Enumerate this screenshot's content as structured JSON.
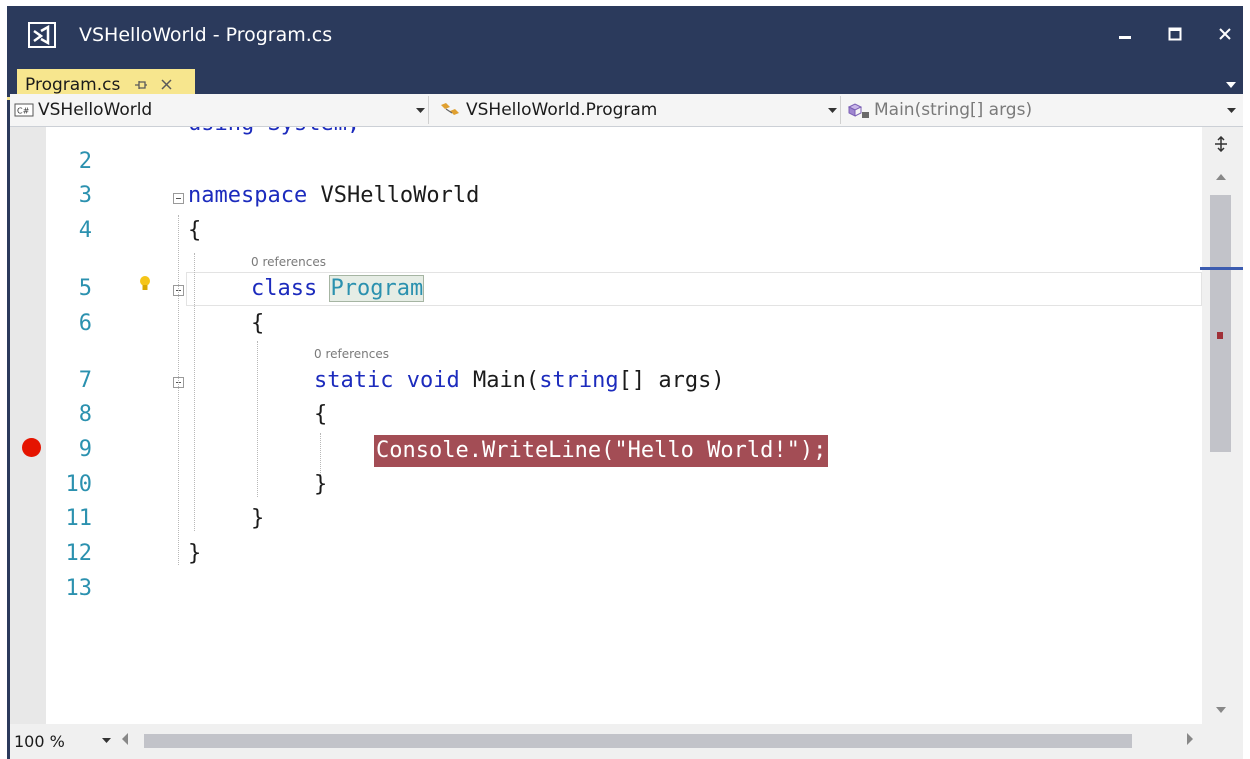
{
  "window": {
    "title": "VSHelloWorld - Program.cs"
  },
  "tab": {
    "label": "Program.cs"
  },
  "nav": {
    "project": "VSHelloWorld",
    "type": "VSHelloWorld.Program",
    "member": "Main(string[] args)"
  },
  "code": {
    "line1_partial": "using System;",
    "references": "0 references",
    "lines": [
      {
        "n": "2",
        "text": ""
      },
      {
        "n": "3",
        "kw": "namespace",
        "rest": " VSHelloWorld"
      },
      {
        "n": "4",
        "text": "{"
      },
      {
        "n": "5",
        "kw": "class",
        "type": "Program"
      },
      {
        "n": "6",
        "text": "{"
      },
      {
        "n": "7",
        "kw": "static void",
        "rest": " Main(",
        "kw2": "string",
        "rest2": "[] args)"
      },
      {
        "n": "8",
        "text": "{"
      },
      {
        "n": "9",
        "text": "Console.WriteLine(\"Hello World!\");"
      },
      {
        "n": "10",
        "text": "}"
      },
      {
        "n": "11",
        "text": "}"
      },
      {
        "n": "12",
        "text": "}"
      },
      {
        "n": "13",
        "text": ""
      }
    ]
  },
  "status": {
    "zoom": "100 %"
  },
  "colors": {
    "chrome": "#2b3a5c",
    "tab": "#f7e68e",
    "breakpoint": "#e51400",
    "breakpoint_line": "#a34d55",
    "keyword": "#1c2bbd",
    "type": "#2b91af"
  }
}
